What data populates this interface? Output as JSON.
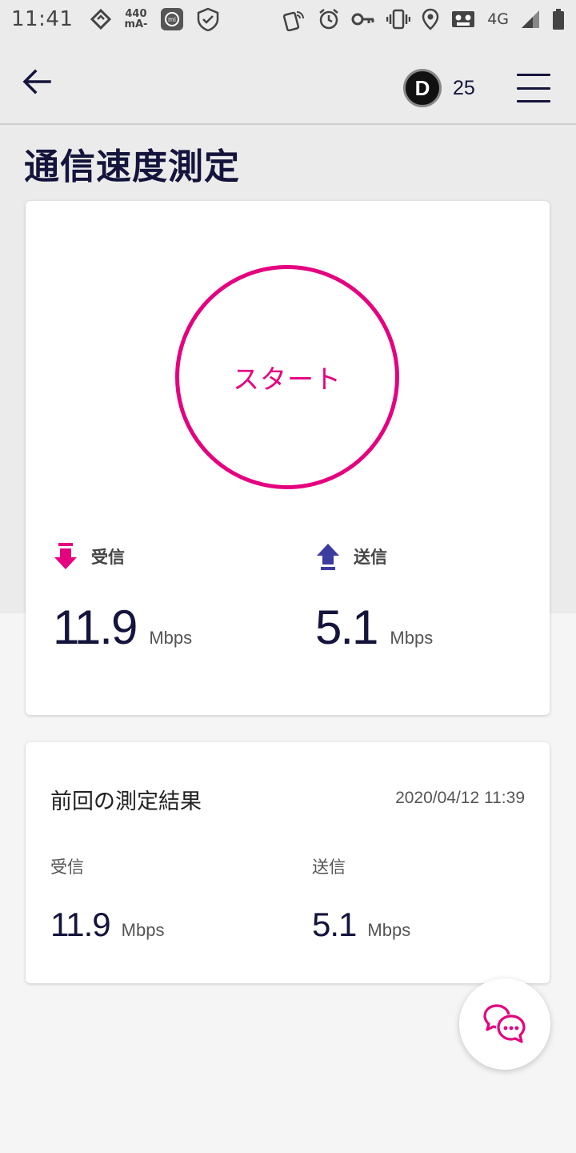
{
  "status_bar": {
    "time": "11:41",
    "current_top": "440",
    "current_bottom": "mA-",
    "network": "4G"
  },
  "header": {
    "points": "25",
    "badge_letter": "D"
  },
  "page_title": "通信速度測定",
  "speed_test": {
    "start_label": "スタート",
    "download": {
      "label": "受信",
      "value": "11.9",
      "unit": "Mbps",
      "color": "#e4007f"
    },
    "upload": {
      "label": "送信",
      "value": "5.1",
      "unit": "Mbps",
      "color": "#3c3ca0"
    }
  },
  "previous_result": {
    "title": "前回の測定結果",
    "date": "2020/04/12 11:39",
    "download": {
      "label": "受信",
      "value": "11.9",
      "unit": "Mbps"
    },
    "upload": {
      "label": "送信",
      "value": "5.1",
      "unit": "Mbps"
    }
  },
  "colors": {
    "accent": "#e4007f",
    "text_dark": "#14143c",
    "upload_icon": "#3c3ca0"
  }
}
